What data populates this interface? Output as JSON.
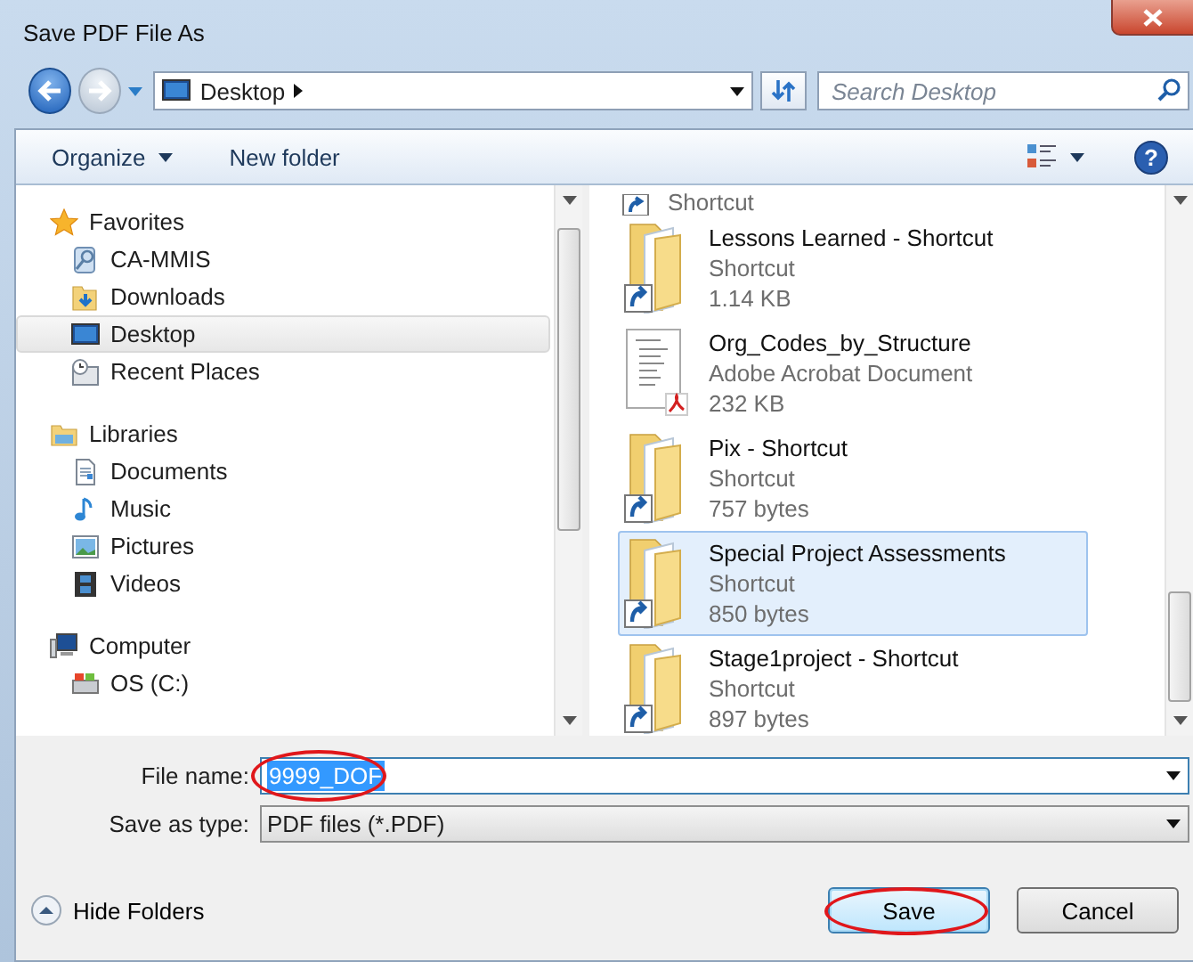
{
  "window": {
    "title": "Save PDF File As"
  },
  "address": {
    "location": "Desktop",
    "search_placeholder": "Search Desktop"
  },
  "toolbar": {
    "organize": "Organize",
    "new_folder": "New folder"
  },
  "toolbar_help": "?",
  "nav": [
    {
      "label": "Favorites",
      "kind": "star",
      "selected": false,
      "children": [
        {
          "label": "CA-MMIS",
          "kind": "network",
          "selected": false
        },
        {
          "label": "Downloads",
          "kind": "downloads",
          "selected": false
        },
        {
          "label": "Desktop",
          "kind": "desktop",
          "selected": true
        },
        {
          "label": "Recent Places",
          "kind": "recent",
          "selected": false
        }
      ]
    },
    {
      "label": "Libraries",
      "kind": "library",
      "selected": false,
      "children": [
        {
          "label": "Documents",
          "kind": "document",
          "selected": false
        },
        {
          "label": "Music",
          "kind": "music",
          "selected": false
        },
        {
          "label": "Pictures",
          "kind": "pictures",
          "selected": false
        },
        {
          "label": "Videos",
          "kind": "videos",
          "selected": false
        }
      ]
    },
    {
      "label": "Computer",
      "kind": "computer",
      "selected": false,
      "children": [
        {
          "label": "OS (C:)",
          "kind": "drive",
          "selected": false
        }
      ]
    }
  ],
  "files": [
    {
      "kind": "partial",
      "type": "Shortcut"
    },
    {
      "kind": "shortcut",
      "name": "Lessons Learned - Shortcut",
      "type": "Shortcut",
      "size": "1.14 KB",
      "selected": false
    },
    {
      "kind": "pdf",
      "name": "Org_Codes_by_Structure",
      "type": "Adobe Acrobat Document",
      "size": "232 KB",
      "selected": false
    },
    {
      "kind": "shortcut",
      "name": "Pix - Shortcut",
      "type": "Shortcut",
      "size": "757 bytes",
      "selected": false
    },
    {
      "kind": "shortcut",
      "name": "Special Project Assessments",
      "type": "Shortcut",
      "size": "850 bytes",
      "selected": true
    },
    {
      "kind": "shortcut",
      "name": "Stage1project - Shortcut",
      "type": "Shortcut",
      "size": "897 bytes",
      "selected": false
    }
  ],
  "file_name": {
    "label": "File name:",
    "value": "9999_DOF",
    "highlighted": true
  },
  "save_type": {
    "label": "Save as type:",
    "value": "PDF files (*.PDF)"
  },
  "hide_folders": "Hide Folders",
  "buttons": [
    {
      "label": "Save",
      "kind": "primary",
      "highlighted": true
    },
    {
      "label": "Cancel",
      "kind": "secondary",
      "highlighted": false
    }
  ]
}
